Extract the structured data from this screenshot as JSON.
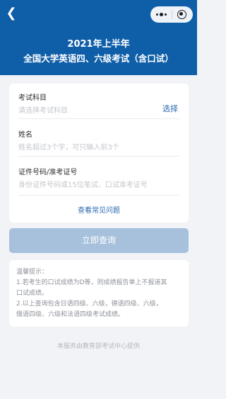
{
  "header": {
    "back_icon": "chevron-left-icon",
    "capsule_icons": [
      "more-dots-icon",
      "close-target-icon"
    ],
    "title_line1": "2021年上半年",
    "title_line2": "全国大学英语四、六级考试（含口试）",
    "bg_color": "#0f5ea8"
  },
  "form": {
    "subject": {
      "label": "考试科目",
      "placeholder": "请选择考试科目",
      "action": "选择"
    },
    "name": {
      "label": "姓名",
      "placeholder": "姓名超过3个字，可只输入前3个"
    },
    "id": {
      "label": "证件号码/准考证号",
      "placeholder": "身份证件号码或15位笔试、口试准考证号"
    },
    "faq_link": "查看常见问题"
  },
  "query_button": {
    "label": "立即查询",
    "color": "#a7c1dd"
  },
  "tips": {
    "lines": [
      "温馨提示：",
      "1.若考生的口试成绩为D等，则成绩报告单上不报道其",
      "口试成绩。",
      "2.以上查询包含日语四级、六级，德语四级、六级，",
      "俄语四级、六级和法语四级考试成绩。"
    ]
  },
  "footer": {
    "text": "本服务由教育部考试中心提供"
  },
  "colors": {
    "accent": "#2c68b2",
    "background": "#f1f3f7"
  }
}
